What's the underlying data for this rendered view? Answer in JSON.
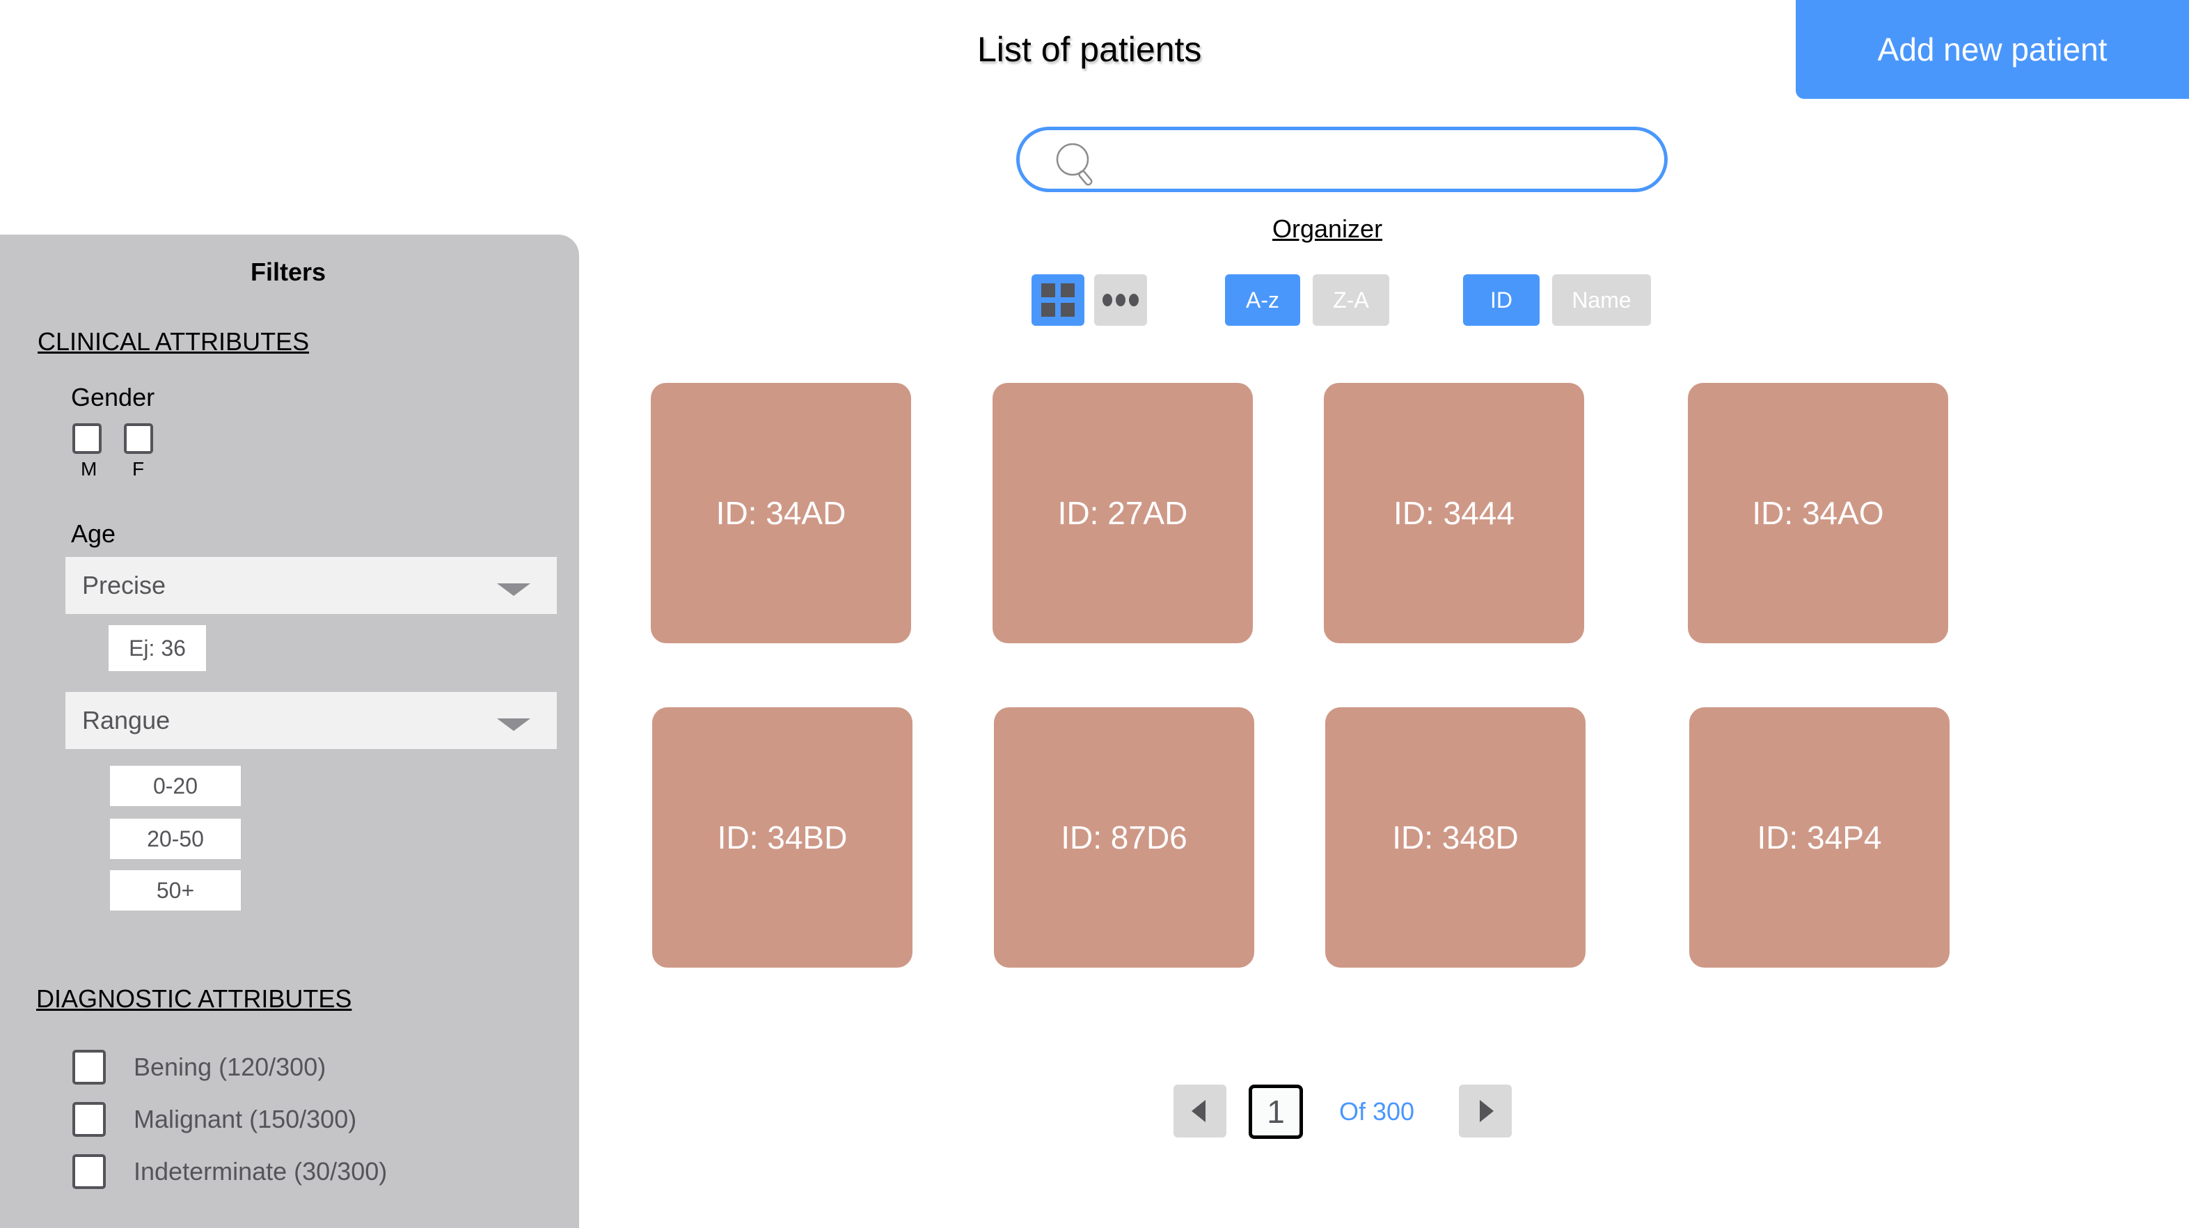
{
  "header": {
    "title": "List of patients",
    "add_button_label": "Add new patient"
  },
  "search": {
    "value": "",
    "placeholder": ""
  },
  "organizer": {
    "label": "Organizer",
    "view_modes": [
      {
        "name": "grid",
        "icon": "grid-icon",
        "active": true
      },
      {
        "name": "list",
        "icon": "dots-icon",
        "active": false
      }
    ],
    "sort_order": [
      {
        "label": "A-z",
        "active": true
      },
      {
        "label": "Z-A",
        "active": false
      }
    ],
    "sort_field": [
      {
        "label": "ID",
        "active": true
      },
      {
        "label": "Name",
        "active": false
      }
    ]
  },
  "filters": {
    "title": "Filters",
    "clinical": {
      "heading": "CLINICAL ATTRIBUTES",
      "gender": {
        "label": "Gender",
        "options": [
          {
            "label": "M",
            "checked": false
          },
          {
            "label": "F",
            "checked": false
          }
        ]
      },
      "age": {
        "label": "Age",
        "precise_select": "Precise",
        "precise_example": "Ej: 36",
        "range_select": "Rangue",
        "ranges": [
          "0-20",
          "20-50",
          "50+"
        ]
      }
    },
    "diagnostic": {
      "heading": "DIAGNOSTIC ATTRIBUTES",
      "options": [
        {
          "label": "Bening (120/300)",
          "checked": false
        },
        {
          "label": "Malignant (150/300)",
          "checked": false
        },
        {
          "label": "Indeterminate (30/300)",
          "checked": false
        }
      ]
    }
  },
  "patients": [
    {
      "label": "ID: 34AD"
    },
    {
      "label": "ID: 27AD"
    },
    {
      "label": "ID: 3444"
    },
    {
      "label": "ID: 34AO"
    },
    {
      "label": "ID: 34BD"
    },
    {
      "label": "ID: 87D6"
    },
    {
      "label": "ID: 348D"
    },
    {
      "label": "ID: 34P4"
    }
  ],
  "pagination": {
    "current_page": "1",
    "of_label": "Of 300"
  },
  "colors": {
    "accent": "#4a97fc",
    "card": "#ce9887",
    "sidebar": "#c5c5c7",
    "inactive_button": "#d9d9d9"
  }
}
